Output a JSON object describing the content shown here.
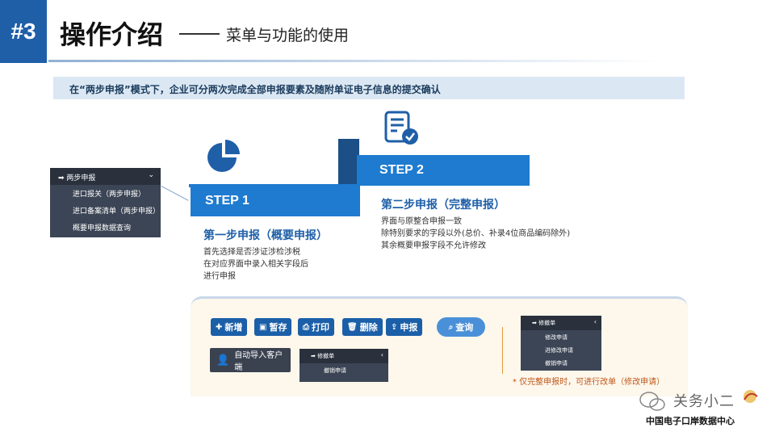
{
  "header": {
    "number": "#3",
    "title": "操作介绍",
    "subtitle": "菜单与功能的使用"
  },
  "intro": "在“两步申报”模式下，企业可分两次完成全部申报要素及随附单证电子信息的提交确认",
  "left_menu": {
    "title": "两步申报",
    "items": [
      "进口报关（两步申报）",
      "进口备案清单（两步申报）",
      "概要申报数据查询"
    ]
  },
  "step1": {
    "label": "STEP 1",
    "title": "第一步申报（概要申报）",
    "lines": [
      "首先选择是否涉证涉检涉税",
      "在对应界面中录入相关字段后",
      "进行申报"
    ]
  },
  "step2": {
    "label": "STEP 2",
    "title": "第二步申报（完整申报）",
    "lines": [
      "界面与原整合申报一致",
      "除特别要求的字段以外(总价、补录4位商品编码除外)",
      "其余概要申报字段不允许修改"
    ]
  },
  "toolbar": {
    "new": "新增",
    "save": "暂存",
    "print": "打印",
    "delete": "删除",
    "declare": "申报",
    "query": "查询"
  },
  "import_button": "自动导入客户端",
  "mini_menu": {
    "title": "修撤单",
    "items": [
      "撤销申请"
    ]
  },
  "right_menu": {
    "title": "修撤单",
    "items": [
      "修改申请",
      "进修改申请",
      "撤销申请"
    ]
  },
  "note": "* 仅完整申报时，可进行改单（修改申请）",
  "watermark": {
    "title": "关务小二",
    "subtitle": "中国电子口岸数据中心"
  },
  "colors": {
    "brand_blue": "#1e7bd0",
    "dark_blue": "#1f5fa8",
    "menu_dark": "#3c4555",
    "note_orange": "#c0581a"
  }
}
